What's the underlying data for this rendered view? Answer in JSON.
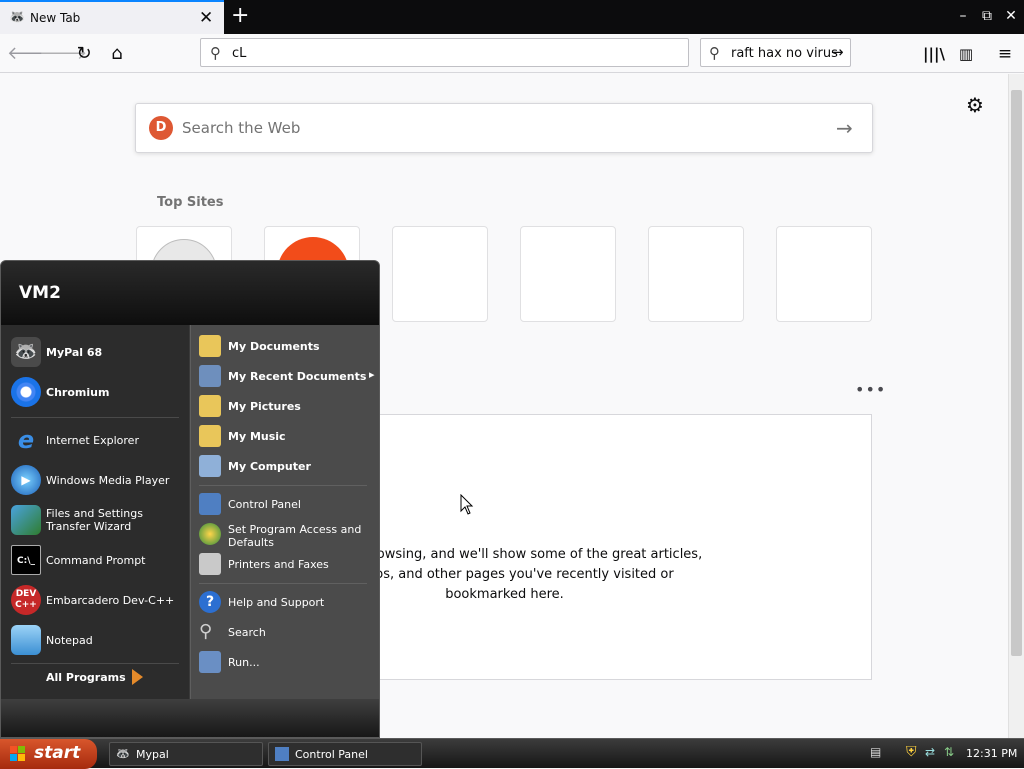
{
  "browser": {
    "tab_title": "New Tab",
    "tab_close": "✕",
    "new_tab": "+",
    "url_value": "cL",
    "search_value": "raft hax no virus",
    "window_buttons": [
      "–",
      "⧉",
      "✕"
    ]
  },
  "newtab": {
    "search_placeholder": "Search the Web",
    "ddg_logo": "D",
    "top_sites_label": "Top Sites",
    "highlights_text_lines": [
      "owsing, and we'll show some of the great articles,",
      "os, and other pages you've recently visited or",
      "bookmarked here."
    ],
    "more_icon": "•••"
  },
  "start_menu": {
    "user": "VM2",
    "pinned": [
      {
        "label": "MyPal 68",
        "icon": "mypal-icon"
      },
      {
        "label": "Chromium",
        "icon": "chromium-icon"
      }
    ],
    "recent": [
      {
        "label": "Internet Explorer",
        "icon": "ie-icon"
      },
      {
        "label": "Windows Media Player",
        "icon": "wmp-icon"
      },
      {
        "label": "Files and Settings Transfer Wizard",
        "icon": "transfer-icon"
      },
      {
        "label": "Command Prompt",
        "icon": "cmd-icon"
      },
      {
        "label": "Embarcadero Dev-C++",
        "icon": "devcpp-icon"
      },
      {
        "label": "Notepad",
        "icon": "notepad-icon"
      }
    ],
    "all_programs": "All Programs",
    "places": [
      {
        "label": "My Documents",
        "bold": true
      },
      {
        "label": "My Recent Documents",
        "bold": true,
        "arrow": "▸"
      },
      {
        "label": "My Pictures",
        "bold": true
      },
      {
        "label": "My Music",
        "bold": true
      },
      {
        "label": "My Computer",
        "bold": true
      }
    ],
    "system": [
      {
        "label": "Control Panel"
      },
      {
        "label": "Set Program Access and Defaults"
      },
      {
        "label": "Printers and Faxes"
      }
    ],
    "help": [
      {
        "label": "Help and Support"
      },
      {
        "label": "Search"
      },
      {
        "label": "Run..."
      }
    ]
  },
  "taskbar": {
    "start_label": "start",
    "tasks": [
      {
        "label": "Mypal"
      },
      {
        "label": "Control Panel"
      }
    ],
    "clock": "12:31 PM"
  }
}
